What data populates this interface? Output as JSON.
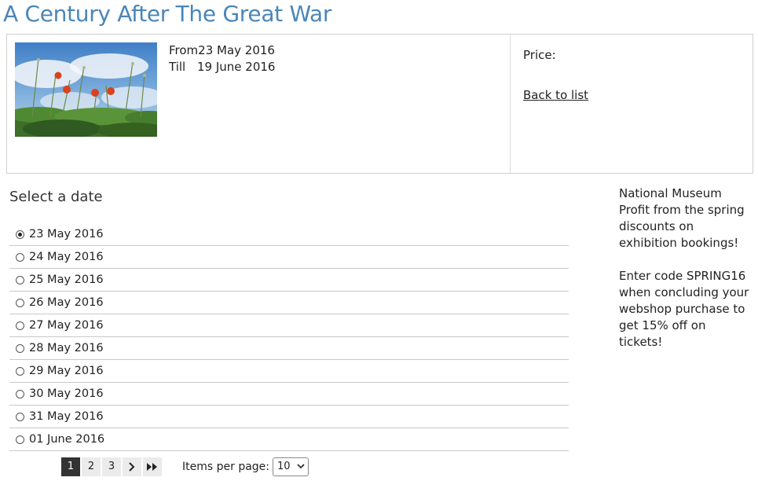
{
  "page": {
    "title": "A Century After The Great War"
  },
  "event": {
    "from_label": "From",
    "from_date": "23 May 2016",
    "till_label": "Till",
    "till_date": "19 June 2016",
    "price_label": "Price:",
    "back_label": "Back to list",
    "image_icon": "poppies-photo"
  },
  "dates": {
    "heading": "Select a date",
    "selected": "23 May 2016",
    "items": [
      {
        "label": "23 May 2016"
      },
      {
        "label": "24 May 2016"
      },
      {
        "label": "25 May 2016"
      },
      {
        "label": "26 May 2016"
      },
      {
        "label": "27 May 2016"
      },
      {
        "label": "28 May 2016"
      },
      {
        "label": "29 May 2016"
      },
      {
        "label": "30 May 2016"
      },
      {
        "label": "31 May 2016"
      },
      {
        "label": "01 June 2016"
      }
    ]
  },
  "pagination": {
    "pages": [
      "1",
      "2",
      "3"
    ],
    "current": "1",
    "next_icon": "chevron-right-icon",
    "last_icon": "double-chevron-right-icon",
    "items_per_page_label": "Items per page:",
    "items_per_page_value": "10"
  },
  "promo": {
    "line1": "National Museum Profit from the spring discounts on exhibition bookings!",
    "line2": "Enter code SPRING16 when concluding your webshop purchase to get 15% off on tickets!"
  },
  "colors": {
    "title": "#4a86b8",
    "active_page": "#333333"
  }
}
